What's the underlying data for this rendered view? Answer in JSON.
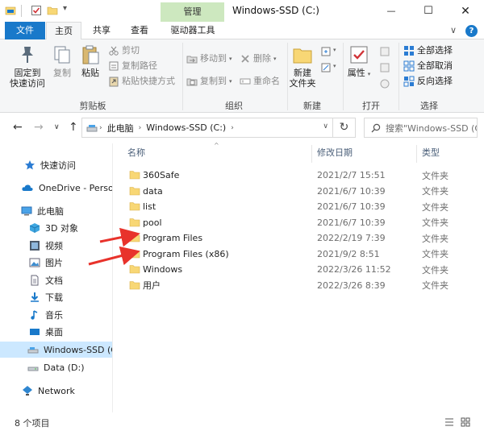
{
  "window": {
    "title": "Windows-SSD (C:)",
    "context_tab": "管理",
    "controls": {
      "minimize": "—",
      "maximize": "☐",
      "close": "✕"
    }
  },
  "ribbon_tabs": {
    "file": "文件",
    "home": "主页",
    "share": "共享",
    "view": "查看",
    "drive_tools": "驱动器工具",
    "collapse": "∨",
    "help": "?"
  },
  "ribbon": {
    "clipboard": {
      "label": "剪贴板",
      "pin": "固定到\n快速访问",
      "copy": "复制",
      "paste": "粘贴",
      "cut": "剪切",
      "copy_path": "复制路径",
      "paste_shortcut": "粘贴快捷方式"
    },
    "organize": {
      "label": "组织",
      "move_to": "移动到",
      "copy_to": "复制到",
      "delete": "删除",
      "rename": "重命名"
    },
    "new": {
      "label": "新建",
      "new_folder": "新建\n文件夹"
    },
    "open": {
      "label": "打开",
      "properties": "属性"
    },
    "select": {
      "label": "选择",
      "select_all": "全部选择",
      "select_none": "全部取消",
      "invert": "反向选择"
    }
  },
  "address": {
    "crumbs": [
      "此电脑",
      "Windows-SSD (C:)"
    ],
    "search_placeholder": "搜索\"Windows-SSD (C:)\""
  },
  "nav": {
    "items": [
      {
        "label": "快速访问",
        "icon": "star-icon"
      },
      {
        "label": "OneDrive - Personal",
        "icon": "cloud-icon"
      },
      {
        "label": "此电脑",
        "icon": "computer-icon"
      },
      {
        "label": "3D 对象",
        "icon": "3d-objects-icon"
      },
      {
        "label": "视频",
        "icon": "video-icon"
      },
      {
        "label": "图片",
        "icon": "picture-icon"
      },
      {
        "label": "文档",
        "icon": "document-icon"
      },
      {
        "label": "下载",
        "icon": "download-icon"
      },
      {
        "label": "音乐",
        "icon": "music-icon"
      },
      {
        "label": "桌面",
        "icon": "desktop-icon"
      },
      {
        "label": "Windows-SSD (C:)",
        "icon": "drive-icon"
      },
      {
        "label": "Data (D:)",
        "icon": "drive-icon"
      },
      {
        "label": "Network",
        "icon": "network-icon"
      }
    ]
  },
  "columns": {
    "name": "名称",
    "date": "修改日期",
    "type": "类型"
  },
  "files": [
    {
      "name": "360Safe",
      "date": "2021/2/7 15:51",
      "type": "文件夹"
    },
    {
      "name": "data",
      "date": "2021/6/7 10:39",
      "type": "文件夹"
    },
    {
      "name": "list",
      "date": "2021/6/7 10:39",
      "type": "文件夹"
    },
    {
      "name": "pool",
      "date": "2021/6/7 10:39",
      "type": "文件夹"
    },
    {
      "name": "Program Files",
      "date": "2022/2/19 7:39",
      "type": "文件夹"
    },
    {
      "name": "Program Files (x86)",
      "date": "2021/9/2 8:51",
      "type": "文件夹"
    },
    {
      "name": "Windows",
      "date": "2022/3/26 11:52",
      "type": "文件夹"
    },
    {
      "name": "用户",
      "date": "2022/3/26 8:39",
      "type": "文件夹"
    }
  ],
  "status": {
    "count": "8 个项目"
  },
  "colors": {
    "accent": "#1979ca",
    "manage_tab": "#cde8bf",
    "selected_nav": "#cce8ff",
    "folder": "#f8d775",
    "annotation_arrow": "#e8322b"
  }
}
